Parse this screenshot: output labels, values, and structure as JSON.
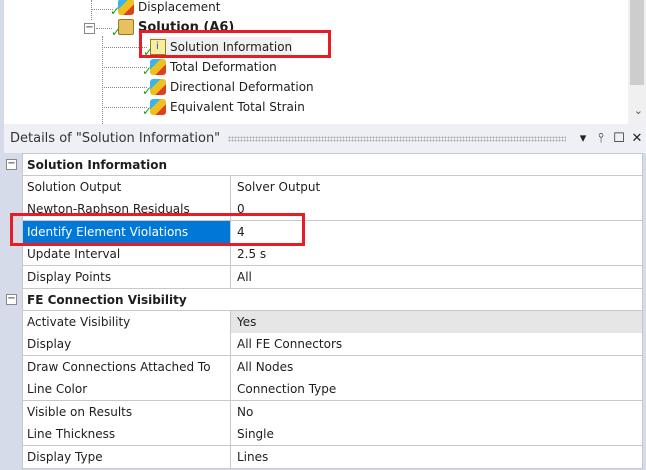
{
  "tree": {
    "items": [
      {
        "label": "Displacement",
        "icon": "displacement-icon"
      },
      {
        "label": "Solution (A6)",
        "icon": "solution-folder-icon"
      },
      {
        "label": "Solution Information",
        "icon": "solution-info-icon"
      },
      {
        "label": "Total Deformation",
        "icon": "result-icon"
      },
      {
        "label": "Directional Deformation",
        "icon": "result-icon"
      },
      {
        "label": "Equivalent Total Strain",
        "icon": "result-icon"
      }
    ],
    "collapse_glyph": "−",
    "scroll_down_glyph": "⌄"
  },
  "details": {
    "title": "Details of \"Solution Information\"",
    "buttons": {
      "menu": "▾",
      "pin": "⫯",
      "maximize": "☐",
      "close": "✕"
    },
    "sections": [
      {
        "title": "Solution Information",
        "rows": [
          {
            "key": "Solution Output",
            "value": "Solver Output"
          },
          {
            "key": "Newton-Raphson Residuals",
            "value": "0"
          },
          {
            "key": "Identify Element Violations",
            "value": "4"
          },
          {
            "key": "Update Interval",
            "value": "2.5 s"
          },
          {
            "key": "Display Points",
            "value": "All"
          }
        ]
      },
      {
        "title": "FE Connection Visibility",
        "rows": [
          {
            "key": "Activate Visibility",
            "value": "Yes"
          },
          {
            "key": "Display",
            "value": "All FE Connectors"
          },
          {
            "key": "Draw Connections Attached To",
            "value": "All Nodes"
          },
          {
            "key": "Line Color",
            "value": "Connection Type"
          },
          {
            "key": "Visible on Results",
            "value": "No"
          },
          {
            "key": "Line Thickness",
            "value": "Single"
          },
          {
            "key": "Display Type",
            "value": "Lines"
          }
        ]
      }
    ]
  },
  "colors": {
    "highlight": "#e81c24",
    "selection": "#0078d7"
  }
}
